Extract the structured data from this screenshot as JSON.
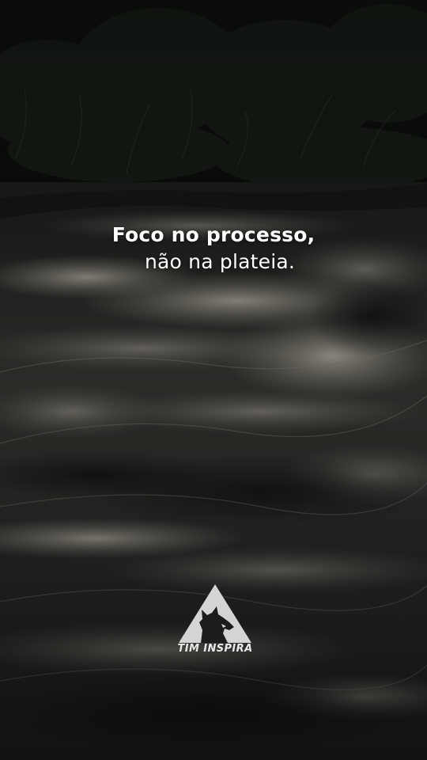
{
  "quote": {
    "line1": "Foco no processo,",
    "line2": "não na plateia."
  },
  "logo": {
    "text": "TIM INSPIRA",
    "icon": "wolf-in-triangle-icon"
  },
  "colors": {
    "text": "#ffffff",
    "logo": "#d9d9d9",
    "water_dark": "#1d1e1c",
    "foam": "#8d8a80",
    "foliage": "#101410"
  }
}
